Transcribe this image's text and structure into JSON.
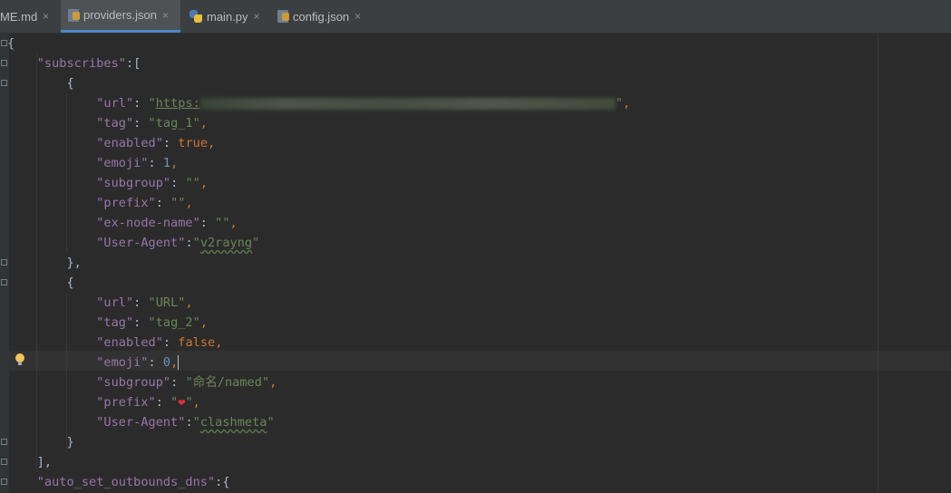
{
  "tabs": [
    {
      "label": "ME.md",
      "icon": "markdown-file-icon",
      "active": false
    },
    {
      "label": "providers.json",
      "icon": "json-file-icon",
      "active": true
    },
    {
      "label": "main.py",
      "icon": "python-file-icon",
      "active": false
    },
    {
      "label": "config.json",
      "icon": "json-file-icon",
      "active": false
    }
  ],
  "close_glyph": "×",
  "code": {
    "l1": "{",
    "l2_key": "\"subscribes\"",
    "l2_rest": ":[",
    "open_brace": "{",
    "close_brace": "}",
    "close_brace_comma": "},",
    "url_key": "\"url\"",
    "url1_val_start": "\"",
    "url1_link": "https:",
    "url1_val_end": "\"",
    "tag_key": "\"tag\"",
    "tag1_val": "\"tag_1\"",
    "enabled_key": "\"enabled\"",
    "enabled1_val": "true",
    "emoji_key": "\"emoji\"",
    "emoji1_val": "1",
    "subgroup_key": "\"subgroup\"",
    "subgroup1_val": "\"\"",
    "prefix_key": "\"prefix\"",
    "prefix1_val": "\"\"",
    "exnode_key": "\"ex-node-name\"",
    "exnode1_val": "\"\"",
    "ua_key": "\"User-Agent\"",
    "ua1_q1": "\"",
    "ua1_val": "v2rayng",
    "ua1_q2": "\"",
    "url2_val": "\"URL\"",
    "tag2_val": "\"tag_2\"",
    "enabled2_val": "false",
    "emoji2_val": "0",
    "subgroup2_val": "\"命名/named\"",
    "prefix2_q1": "\"",
    "prefix2_emoji": "❤",
    "prefix2_q2": "\"",
    "ua2_q1": "\"",
    "ua2_val": "clashmeta",
    "ua2_q2": "\"",
    "arr_close": "],",
    "dns_key": "\"auto_set_outbounds_dns\"",
    "dns_rest": ":{"
  },
  "colors": {
    "background": "#2b2b2b",
    "key": "#9876aa",
    "string": "#6a8759",
    "number": "#6897bb",
    "keyword": "#cc7832",
    "active_tab_underline": "#4a88c7"
  }
}
